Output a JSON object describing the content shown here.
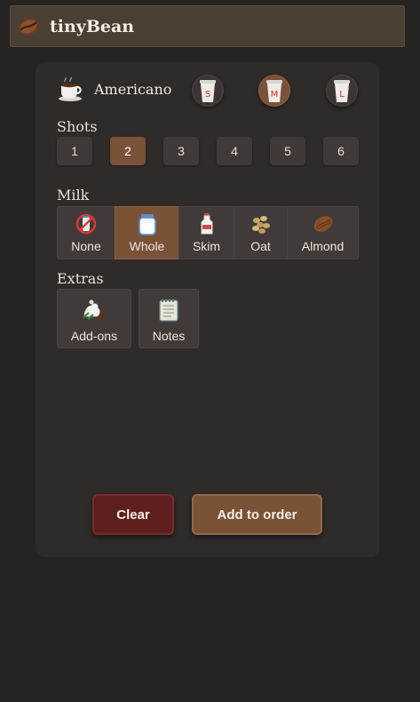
{
  "app": {
    "title": "tinyBean",
    "logo_icon": "coffee-bean-icon"
  },
  "drink": {
    "name": "Americano",
    "icon": "coffee-cup-icon"
  },
  "sizes": [
    {
      "label": "S",
      "selected": false
    },
    {
      "label": "M",
      "selected": true
    },
    {
      "label": "L",
      "selected": false
    }
  ],
  "shots": {
    "label": "Shots",
    "options": [
      "1",
      "2",
      "3",
      "4",
      "5",
      "6"
    ],
    "selected": "2"
  },
  "milk": {
    "label": "Milk",
    "options": [
      {
        "label": "None",
        "icon": "no-milk-icon"
      },
      {
        "label": "Whole",
        "icon": "milk-jar-icon"
      },
      {
        "label": "Skim",
        "icon": "milk-bottle-icon"
      },
      {
        "label": "Oat",
        "icon": "oats-icon"
      },
      {
        "label": "Almond",
        "icon": "almond-icon"
      }
    ],
    "selected": "Whole"
  },
  "extras": {
    "label": "Extras",
    "items": [
      {
        "label": "Add-ons",
        "icon": "whipped-cream-icon"
      },
      {
        "label": "Notes",
        "icon": "notepad-icon"
      }
    ]
  },
  "actions": {
    "clear": "Clear",
    "add": "Add to order"
  },
  "colors": {
    "accent": "#7a5238",
    "danger": "#5e1f1f",
    "background": "#262322",
    "card": "#2f2b29"
  }
}
